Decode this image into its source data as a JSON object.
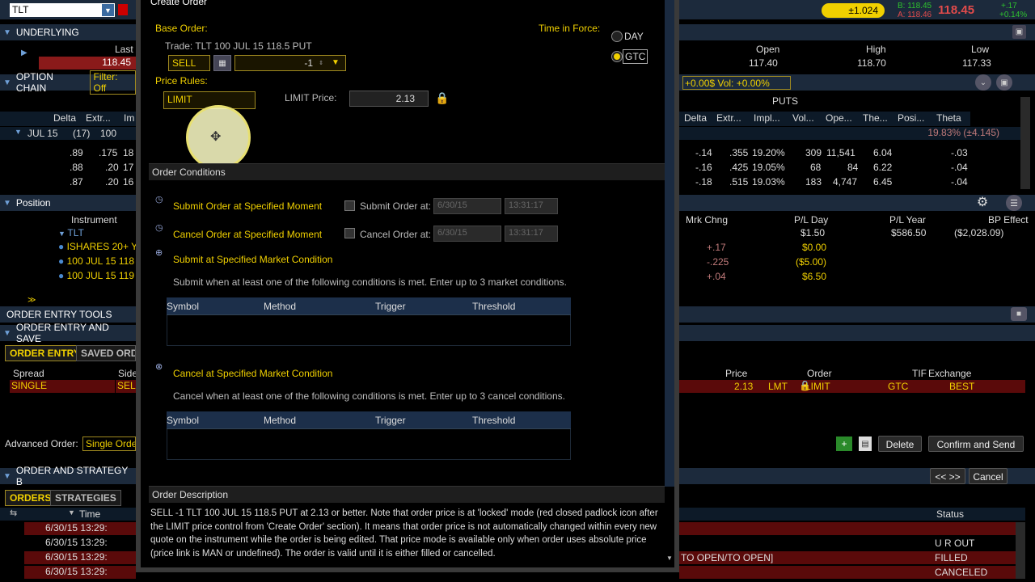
{
  "top": {
    "symbol": "TLT",
    "badge": "±1.024",
    "bid": "B: 118.45",
    "ask": "A: 118.46",
    "last": "118.45",
    "chg": "+.17",
    "chg_pct": "+0.14%"
  },
  "underlying": {
    "title": "UNDERLYING",
    "last_label": "Last",
    "last_value": "118.45",
    "open_label": "Open",
    "open_value": "117.40",
    "high_label": "High",
    "high_value": "118.70",
    "low_label": "Low",
    "low_value": "117.33"
  },
  "option_chain": {
    "title": "OPTION CHAIN",
    "filter": "Filter: Off",
    "right_filter": "+0.00$ Vol: +0.00%",
    "puts_label": "PUTS",
    "left_cols": [
      "Delta",
      "Extr...",
      "Im"
    ],
    "right_cols": [
      "Delta",
      "Extr...",
      "Impl...",
      "Vol...",
      "Ope...",
      "The...",
      "Posi...",
      "Theta"
    ],
    "expiry": "JUL 15",
    "expiry_count": "(17)",
    "expiry_mult": "100",
    "expiry_right": "19.83% (±4.145)",
    "left_rows": [
      {
        "delta": ".89",
        "extr": ".175",
        "im": "18"
      },
      {
        "delta": ".88",
        "extr": ".20",
        "im": "17"
      },
      {
        "delta": ".87",
        "extr": ".20",
        "im": "16"
      }
    ],
    "right_rows": [
      {
        "delta": "-.14",
        "extr": ".355",
        "impl": "19.20%",
        "vol": "309",
        "ope": "11,541",
        "the": "6.04",
        "theta": "-.03"
      },
      {
        "delta": "-.16",
        "extr": ".425",
        "impl": "19.05%",
        "vol": "68",
        "ope": "84",
        "the": "6.22",
        "theta": "-.04"
      },
      {
        "delta": "-.18",
        "extr": ".515",
        "impl": "19.03%",
        "vol": "183",
        "ope": "4,747",
        "the": "6.45",
        "theta": "-.04"
      }
    ]
  },
  "position": {
    "title": "Position",
    "instrument_label": "Instrument",
    "cols": [
      "Mrk Chng",
      "P/L Day",
      "P/L Year",
      "BP Effect"
    ],
    "group": "TLT",
    "group_vals": [
      "",
      "$1.50",
      "$586.50",
      "($2,028.09)"
    ],
    "rows": [
      {
        "name": "ISHARES 20+ Y",
        "mrk": "+.17",
        "pl": "$0.00"
      },
      {
        "name": "100 JUL 15 118",
        "mrk": "-.225",
        "pl": "($5.00)"
      },
      {
        "name": "100 JUL 15 119",
        "mrk": "+.04",
        "pl": "$6.50"
      }
    ]
  },
  "order_entry": {
    "tools_title": "ORDER ENTRY TOOLS",
    "entry_title": "ORDER ENTRY AND SAVE",
    "tab_entry": "ORDER ENTRY",
    "tab_saved": "SAVED ORD",
    "spread_label": "Spread",
    "side_label": "Side",
    "spread_value": "SINGLE",
    "side_value": "SEL",
    "price_label": "Price",
    "order_label": "Order",
    "tif_label": "TIF",
    "exchange_label": "Exchange",
    "price_value": "2.13",
    "lmt": "LMT",
    "order_value": "LIMIT",
    "tif_value": "GTC",
    "exchange_value": "BEST",
    "advanced_label": "Advanced Order:",
    "advanced_value": "Single Orde",
    "delete": "Delete",
    "confirm": "Confirm and Send",
    "nav": "<< >>",
    "cancel": "Cancel"
  },
  "orders": {
    "title": "ORDER AND STRATEGY B",
    "tab_orders": "ORDERS",
    "tab_strategies": "STRATEGIES",
    "time_label": "Time",
    "status_label": "Status",
    "rows": [
      {
        "time": "6/30/15 13:29:",
        "desc": "",
        "status": ""
      },
      {
        "time": "6/30/15 13:29:",
        "desc": "",
        "status": "U R OUT"
      },
      {
        "time": "6/30/15 13:29:",
        "desc": "TO OPEN/TO OPEN]",
        "status": "FILLED"
      },
      {
        "time": "6/30/15 13:29:",
        "desc": "",
        "status": "CANCELED"
      }
    ]
  },
  "dialog": {
    "title": "Create Order",
    "base_order": "Base Order:",
    "trade": "Trade:  TLT 100 JUL 15 118.5 PUT",
    "side": "SELL",
    "qty": "-1",
    "tif_label": "Time in Force:",
    "tif_day": "DAY",
    "tif_gtc": "GTC",
    "price_rules": "Price Rules:",
    "price_rule": "LIMIT",
    "limit_price_label": "LIMIT Price:",
    "limit_price": "2.13",
    "conditions_title": "Order Conditions",
    "submit_moment": "Submit Order at Specified Moment",
    "submit_at": "Submit Order at:",
    "cancel_moment": "Cancel Order at Specified Moment",
    "cancel_at": "Cancel Order at:",
    "date": "6/30/15",
    "time": "13:31:17",
    "submit_market": "Submit at Specified Market Condition",
    "submit_desc": "Submit when at least one of the following conditions is met. Enter up to 3 market conditions.",
    "cancel_market": "Cancel at Specified Market Condition",
    "cancel_desc": "Cancel when at least one of the following conditions is met. Enter up to 3 cancel conditions.",
    "table_cols": [
      "Symbol",
      "Method",
      "Trigger",
      "Threshold"
    ],
    "desc_title": "Order Description",
    "description": "SELL -1 TLT 100 JUL 15 118.5 PUT at 2.13 or better. Note that order price is at 'locked' mode (red closed padlock icon after the LIMIT price control from 'Create Order' section). It means that order price is not automatically changed within every new quote on the instrument while the order is being edited. That price mode is available only when order uses absolute price (price link is MAN or undefined). The order is valid until it is either filled or cancelled."
  },
  "colors": {
    "accent": "#f0d000",
    "header": "#1c2a3c",
    "red": "#e14b4b"
  }
}
